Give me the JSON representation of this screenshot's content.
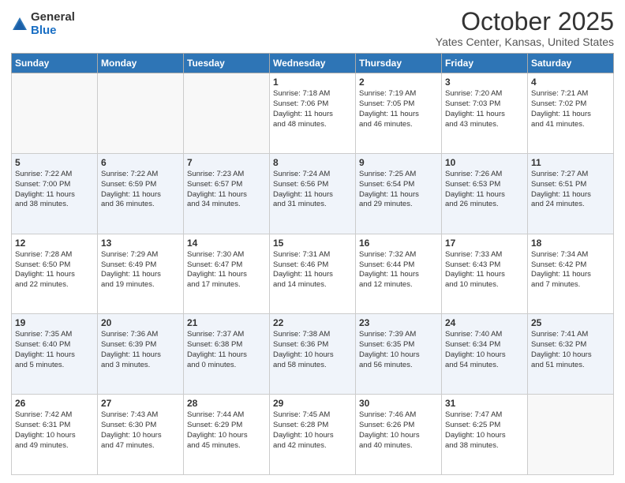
{
  "logo": {
    "general": "General",
    "blue": "Blue"
  },
  "header": {
    "month": "October 2025",
    "location": "Yates Center, Kansas, United States"
  },
  "days_of_week": [
    "Sunday",
    "Monday",
    "Tuesday",
    "Wednesday",
    "Thursday",
    "Friday",
    "Saturday"
  ],
  "weeks": [
    [
      {
        "num": "",
        "info": ""
      },
      {
        "num": "",
        "info": ""
      },
      {
        "num": "",
        "info": ""
      },
      {
        "num": "1",
        "info": "Sunrise: 7:18 AM\nSunset: 7:06 PM\nDaylight: 11 hours\nand 48 minutes."
      },
      {
        "num": "2",
        "info": "Sunrise: 7:19 AM\nSunset: 7:05 PM\nDaylight: 11 hours\nand 46 minutes."
      },
      {
        "num": "3",
        "info": "Sunrise: 7:20 AM\nSunset: 7:03 PM\nDaylight: 11 hours\nand 43 minutes."
      },
      {
        "num": "4",
        "info": "Sunrise: 7:21 AM\nSunset: 7:02 PM\nDaylight: 11 hours\nand 41 minutes."
      }
    ],
    [
      {
        "num": "5",
        "info": "Sunrise: 7:22 AM\nSunset: 7:00 PM\nDaylight: 11 hours\nand 38 minutes."
      },
      {
        "num": "6",
        "info": "Sunrise: 7:22 AM\nSunset: 6:59 PM\nDaylight: 11 hours\nand 36 minutes."
      },
      {
        "num": "7",
        "info": "Sunrise: 7:23 AM\nSunset: 6:57 PM\nDaylight: 11 hours\nand 34 minutes."
      },
      {
        "num": "8",
        "info": "Sunrise: 7:24 AM\nSunset: 6:56 PM\nDaylight: 11 hours\nand 31 minutes."
      },
      {
        "num": "9",
        "info": "Sunrise: 7:25 AM\nSunset: 6:54 PM\nDaylight: 11 hours\nand 29 minutes."
      },
      {
        "num": "10",
        "info": "Sunrise: 7:26 AM\nSunset: 6:53 PM\nDaylight: 11 hours\nand 26 minutes."
      },
      {
        "num": "11",
        "info": "Sunrise: 7:27 AM\nSunset: 6:51 PM\nDaylight: 11 hours\nand 24 minutes."
      }
    ],
    [
      {
        "num": "12",
        "info": "Sunrise: 7:28 AM\nSunset: 6:50 PM\nDaylight: 11 hours\nand 22 minutes."
      },
      {
        "num": "13",
        "info": "Sunrise: 7:29 AM\nSunset: 6:49 PM\nDaylight: 11 hours\nand 19 minutes."
      },
      {
        "num": "14",
        "info": "Sunrise: 7:30 AM\nSunset: 6:47 PM\nDaylight: 11 hours\nand 17 minutes."
      },
      {
        "num": "15",
        "info": "Sunrise: 7:31 AM\nSunset: 6:46 PM\nDaylight: 11 hours\nand 14 minutes."
      },
      {
        "num": "16",
        "info": "Sunrise: 7:32 AM\nSunset: 6:44 PM\nDaylight: 11 hours\nand 12 minutes."
      },
      {
        "num": "17",
        "info": "Sunrise: 7:33 AM\nSunset: 6:43 PM\nDaylight: 11 hours\nand 10 minutes."
      },
      {
        "num": "18",
        "info": "Sunrise: 7:34 AM\nSunset: 6:42 PM\nDaylight: 11 hours\nand 7 minutes."
      }
    ],
    [
      {
        "num": "19",
        "info": "Sunrise: 7:35 AM\nSunset: 6:40 PM\nDaylight: 11 hours\nand 5 minutes."
      },
      {
        "num": "20",
        "info": "Sunrise: 7:36 AM\nSunset: 6:39 PM\nDaylight: 11 hours\nand 3 minutes."
      },
      {
        "num": "21",
        "info": "Sunrise: 7:37 AM\nSunset: 6:38 PM\nDaylight: 11 hours\nand 0 minutes."
      },
      {
        "num": "22",
        "info": "Sunrise: 7:38 AM\nSunset: 6:36 PM\nDaylight: 10 hours\nand 58 minutes."
      },
      {
        "num": "23",
        "info": "Sunrise: 7:39 AM\nSunset: 6:35 PM\nDaylight: 10 hours\nand 56 minutes."
      },
      {
        "num": "24",
        "info": "Sunrise: 7:40 AM\nSunset: 6:34 PM\nDaylight: 10 hours\nand 54 minutes."
      },
      {
        "num": "25",
        "info": "Sunrise: 7:41 AM\nSunset: 6:32 PM\nDaylight: 10 hours\nand 51 minutes."
      }
    ],
    [
      {
        "num": "26",
        "info": "Sunrise: 7:42 AM\nSunset: 6:31 PM\nDaylight: 10 hours\nand 49 minutes."
      },
      {
        "num": "27",
        "info": "Sunrise: 7:43 AM\nSunset: 6:30 PM\nDaylight: 10 hours\nand 47 minutes."
      },
      {
        "num": "28",
        "info": "Sunrise: 7:44 AM\nSunset: 6:29 PM\nDaylight: 10 hours\nand 45 minutes."
      },
      {
        "num": "29",
        "info": "Sunrise: 7:45 AM\nSunset: 6:28 PM\nDaylight: 10 hours\nand 42 minutes."
      },
      {
        "num": "30",
        "info": "Sunrise: 7:46 AM\nSunset: 6:26 PM\nDaylight: 10 hours\nand 40 minutes."
      },
      {
        "num": "31",
        "info": "Sunrise: 7:47 AM\nSunset: 6:25 PM\nDaylight: 10 hours\nand 38 minutes."
      },
      {
        "num": "",
        "info": ""
      }
    ]
  ]
}
